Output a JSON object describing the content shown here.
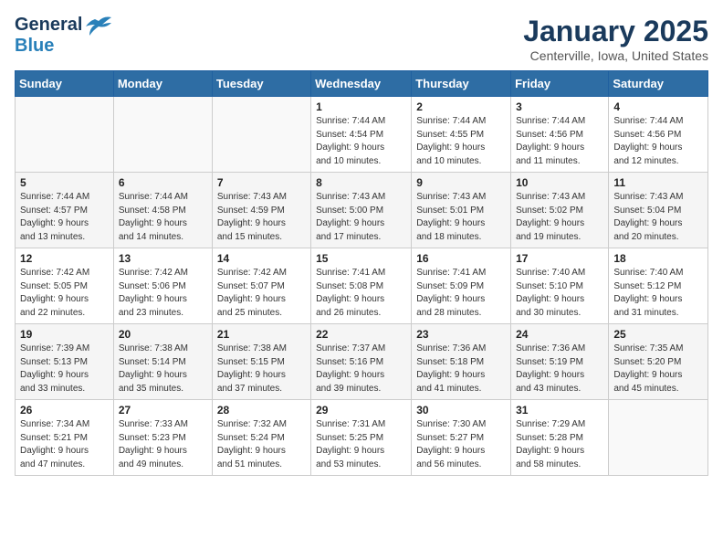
{
  "header": {
    "logo_line1": "General",
    "logo_line2": "Blue",
    "title": "January 2025",
    "subtitle": "Centerville, Iowa, United States"
  },
  "weekdays": [
    "Sunday",
    "Monday",
    "Tuesday",
    "Wednesday",
    "Thursday",
    "Friday",
    "Saturday"
  ],
  "weeks": [
    [
      {
        "day": "",
        "info": ""
      },
      {
        "day": "",
        "info": ""
      },
      {
        "day": "",
        "info": ""
      },
      {
        "day": "1",
        "info": "Sunrise: 7:44 AM\nSunset: 4:54 PM\nDaylight: 9 hours\nand 10 minutes."
      },
      {
        "day": "2",
        "info": "Sunrise: 7:44 AM\nSunset: 4:55 PM\nDaylight: 9 hours\nand 10 minutes."
      },
      {
        "day": "3",
        "info": "Sunrise: 7:44 AM\nSunset: 4:56 PM\nDaylight: 9 hours\nand 11 minutes."
      },
      {
        "day": "4",
        "info": "Sunrise: 7:44 AM\nSunset: 4:56 PM\nDaylight: 9 hours\nand 12 minutes."
      }
    ],
    [
      {
        "day": "5",
        "info": "Sunrise: 7:44 AM\nSunset: 4:57 PM\nDaylight: 9 hours\nand 13 minutes."
      },
      {
        "day": "6",
        "info": "Sunrise: 7:44 AM\nSunset: 4:58 PM\nDaylight: 9 hours\nand 14 minutes."
      },
      {
        "day": "7",
        "info": "Sunrise: 7:43 AM\nSunset: 4:59 PM\nDaylight: 9 hours\nand 15 minutes."
      },
      {
        "day": "8",
        "info": "Sunrise: 7:43 AM\nSunset: 5:00 PM\nDaylight: 9 hours\nand 17 minutes."
      },
      {
        "day": "9",
        "info": "Sunrise: 7:43 AM\nSunset: 5:01 PM\nDaylight: 9 hours\nand 18 minutes."
      },
      {
        "day": "10",
        "info": "Sunrise: 7:43 AM\nSunset: 5:02 PM\nDaylight: 9 hours\nand 19 minutes."
      },
      {
        "day": "11",
        "info": "Sunrise: 7:43 AM\nSunset: 5:04 PM\nDaylight: 9 hours\nand 20 minutes."
      }
    ],
    [
      {
        "day": "12",
        "info": "Sunrise: 7:42 AM\nSunset: 5:05 PM\nDaylight: 9 hours\nand 22 minutes."
      },
      {
        "day": "13",
        "info": "Sunrise: 7:42 AM\nSunset: 5:06 PM\nDaylight: 9 hours\nand 23 minutes."
      },
      {
        "day": "14",
        "info": "Sunrise: 7:42 AM\nSunset: 5:07 PM\nDaylight: 9 hours\nand 25 minutes."
      },
      {
        "day": "15",
        "info": "Sunrise: 7:41 AM\nSunset: 5:08 PM\nDaylight: 9 hours\nand 26 minutes."
      },
      {
        "day": "16",
        "info": "Sunrise: 7:41 AM\nSunset: 5:09 PM\nDaylight: 9 hours\nand 28 minutes."
      },
      {
        "day": "17",
        "info": "Sunrise: 7:40 AM\nSunset: 5:10 PM\nDaylight: 9 hours\nand 30 minutes."
      },
      {
        "day": "18",
        "info": "Sunrise: 7:40 AM\nSunset: 5:12 PM\nDaylight: 9 hours\nand 31 minutes."
      }
    ],
    [
      {
        "day": "19",
        "info": "Sunrise: 7:39 AM\nSunset: 5:13 PM\nDaylight: 9 hours\nand 33 minutes."
      },
      {
        "day": "20",
        "info": "Sunrise: 7:38 AM\nSunset: 5:14 PM\nDaylight: 9 hours\nand 35 minutes."
      },
      {
        "day": "21",
        "info": "Sunrise: 7:38 AM\nSunset: 5:15 PM\nDaylight: 9 hours\nand 37 minutes."
      },
      {
        "day": "22",
        "info": "Sunrise: 7:37 AM\nSunset: 5:16 PM\nDaylight: 9 hours\nand 39 minutes."
      },
      {
        "day": "23",
        "info": "Sunrise: 7:36 AM\nSunset: 5:18 PM\nDaylight: 9 hours\nand 41 minutes."
      },
      {
        "day": "24",
        "info": "Sunrise: 7:36 AM\nSunset: 5:19 PM\nDaylight: 9 hours\nand 43 minutes."
      },
      {
        "day": "25",
        "info": "Sunrise: 7:35 AM\nSunset: 5:20 PM\nDaylight: 9 hours\nand 45 minutes."
      }
    ],
    [
      {
        "day": "26",
        "info": "Sunrise: 7:34 AM\nSunset: 5:21 PM\nDaylight: 9 hours\nand 47 minutes."
      },
      {
        "day": "27",
        "info": "Sunrise: 7:33 AM\nSunset: 5:23 PM\nDaylight: 9 hours\nand 49 minutes."
      },
      {
        "day": "28",
        "info": "Sunrise: 7:32 AM\nSunset: 5:24 PM\nDaylight: 9 hours\nand 51 minutes."
      },
      {
        "day": "29",
        "info": "Sunrise: 7:31 AM\nSunset: 5:25 PM\nDaylight: 9 hours\nand 53 minutes."
      },
      {
        "day": "30",
        "info": "Sunrise: 7:30 AM\nSunset: 5:27 PM\nDaylight: 9 hours\nand 56 minutes."
      },
      {
        "day": "31",
        "info": "Sunrise: 7:29 AM\nSunset: 5:28 PM\nDaylight: 9 hours\nand 58 minutes."
      },
      {
        "day": "",
        "info": ""
      }
    ]
  ]
}
